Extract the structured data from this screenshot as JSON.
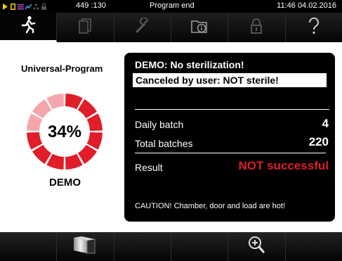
{
  "status": {
    "code": "449 :130",
    "title": "Program end",
    "datetime": "11:46  04.02.2016",
    "icons": [
      "play-icon",
      "door-icon",
      "menu-icon",
      "chart-icon",
      "network-icon",
      "lock-icon"
    ]
  },
  "tabs": [
    {
      "icon": "running-person-icon",
      "active": true
    },
    {
      "icon": "document-icon",
      "active": false
    },
    {
      "icon": "wrench-icon",
      "active": false
    },
    {
      "icon": "info-card-icon",
      "active": false
    },
    {
      "icon": "padlock-icon",
      "active": false
    },
    {
      "icon": "help-icon",
      "active": false
    }
  ],
  "program": {
    "title": "Universal-Program",
    "progress_percent": 34,
    "progress_label": "34%",
    "mode": "DEMO"
  },
  "panel": {
    "heading": "DEMO: No sterilization!",
    "banner": "Canceled by user: NOT sterile!",
    "daily_batch_label": "Daily batch",
    "daily_batch_value": "4",
    "total_batches_label": "Total batches",
    "total_batches_value": "220",
    "result_label": "Result",
    "result_value": "NOT successful",
    "caution": "CAUTION! Chamber, door and load are hot!"
  },
  "bottom_bar": {
    "buttons": [
      "",
      "door-open-icon",
      "",
      "",
      "zoom-in-icon",
      ""
    ]
  },
  "colors": {
    "accent_red": "#e01d28",
    "progress_remaining": "#f5a6ac"
  }
}
